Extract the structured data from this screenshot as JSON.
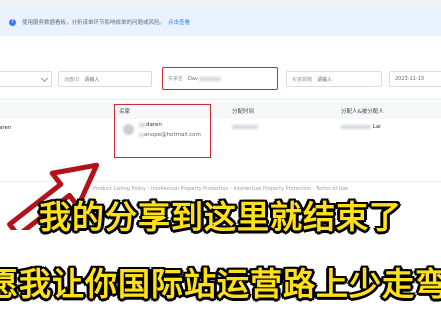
{
  "notice": {
    "text": "使用服务数据看板，分析该单环节影响成单的问题或风险。",
    "link": "点击查看"
  },
  "filters": {
    "f2_label": "询盘ID",
    "f2_placeholder": "请输入",
    "f3_label": "买家名",
    "f3_value": "Dav",
    "f4_label": "买家邮箱",
    "f4_placeholder": "请输入",
    "f5_value": "2023-11-13"
  },
  "table": {
    "headers": [
      "买家",
      "分配时间",
      "分配人&被分配人"
    ],
    "row": {
      "left_name": "aren",
      "buyer_name": "daren",
      "buyer_email": "anope@hotmail.com",
      "assignee_suffix": "Lai"
    }
  },
  "footer": {
    "text": "Product Listing Policy - Intellectual Property Protection - Intellectual Property Protection - Terms of Use"
  },
  "captions": {
    "line1": "我的分享到这里就结束了",
    "line2": "愿我让你国际站运营路上少走弯"
  },
  "colors": {
    "highlight": "#d7272f",
    "caption_fill": "#ffe01a",
    "caption_stroke": "#000000",
    "notice_bg": "#eaf2ff",
    "link": "#3a7bf3"
  }
}
